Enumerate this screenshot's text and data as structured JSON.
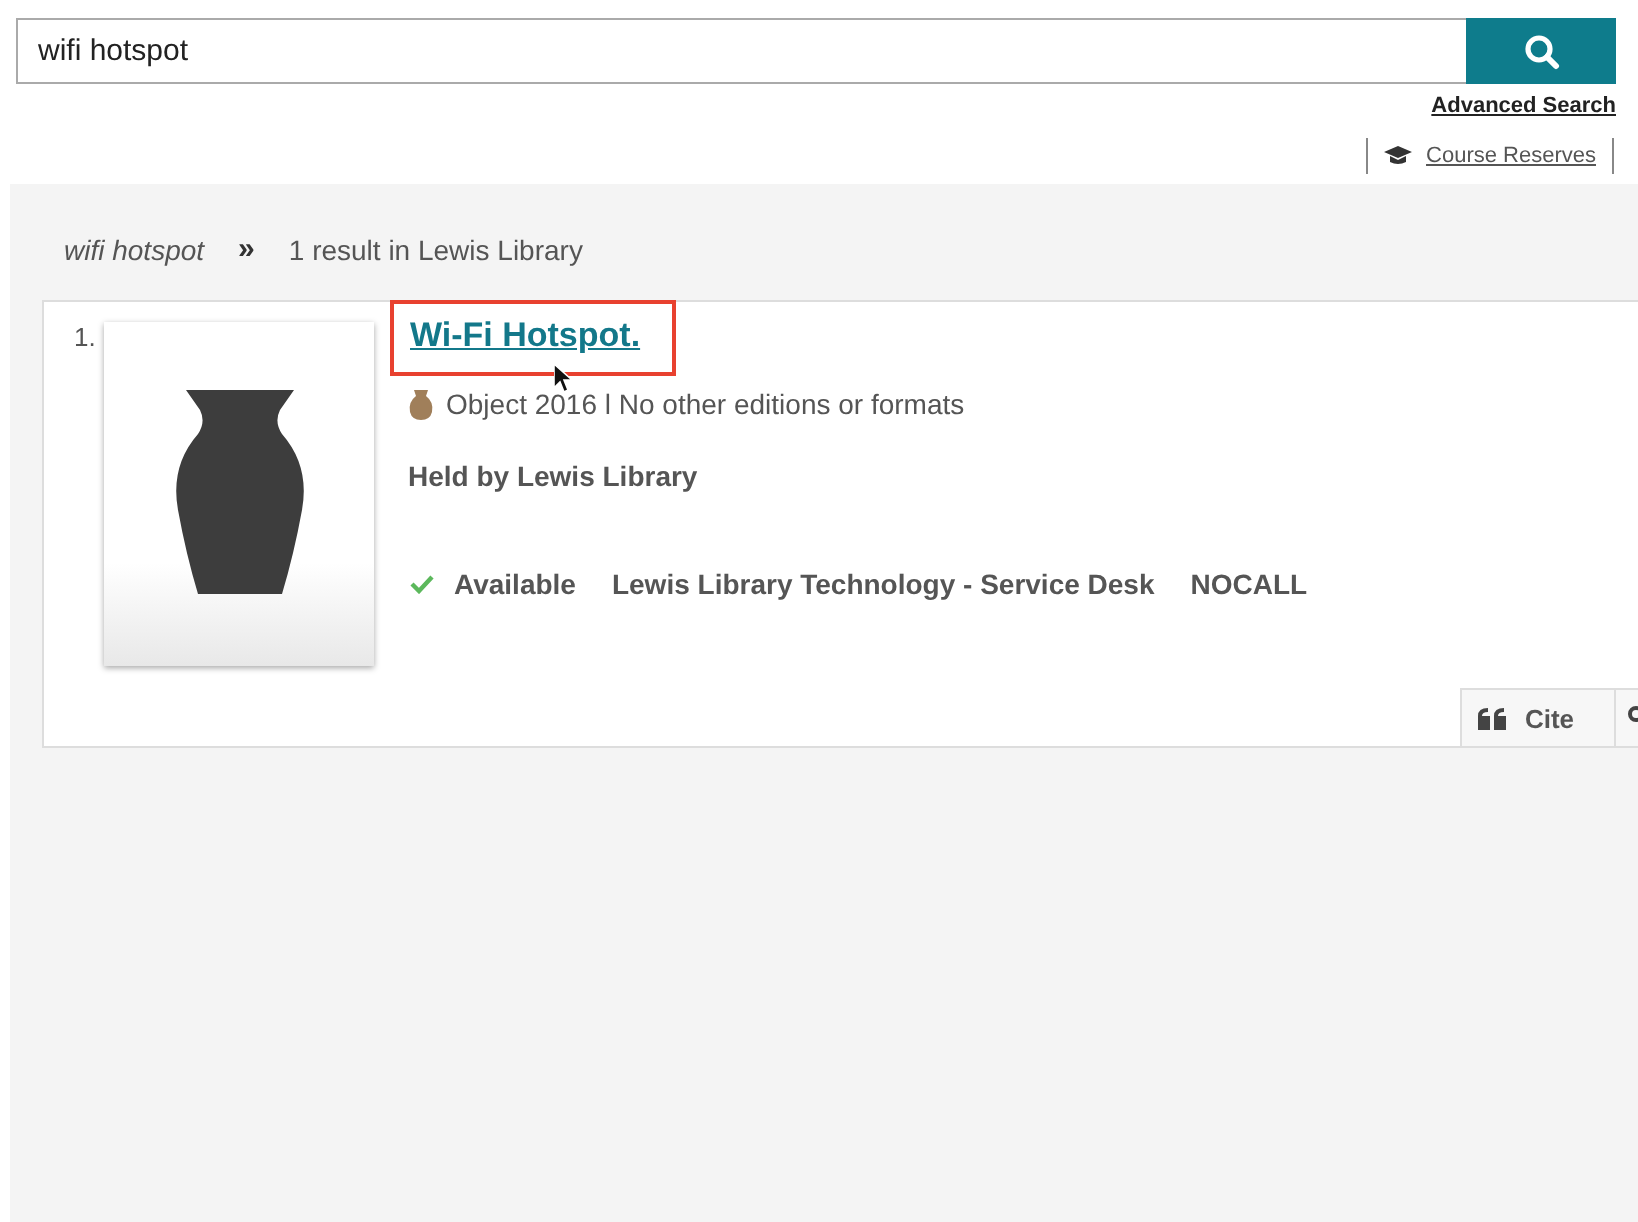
{
  "search": {
    "value": "wifi hotspot",
    "advanced_link": "Advanced Search"
  },
  "nav": [
    {
      "label": "Course Reserves"
    }
  ],
  "breadcrumb": {
    "query": "wifi hotspot",
    "separator": "»",
    "summary": "1 result in Lewis Library"
  },
  "results": [
    {
      "number": "1.",
      "title": "Wi-Fi Hotspot.",
      "highlighted": true,
      "format": "Object 2016 l No other editions or formats",
      "held_by": "Held by Lewis Library",
      "available": true,
      "availability": "Available",
      "location": "Lewis Library Technology - Service Desk",
      "call_number": "NOCALL",
      "cite_label": "Cite"
    }
  ]
}
